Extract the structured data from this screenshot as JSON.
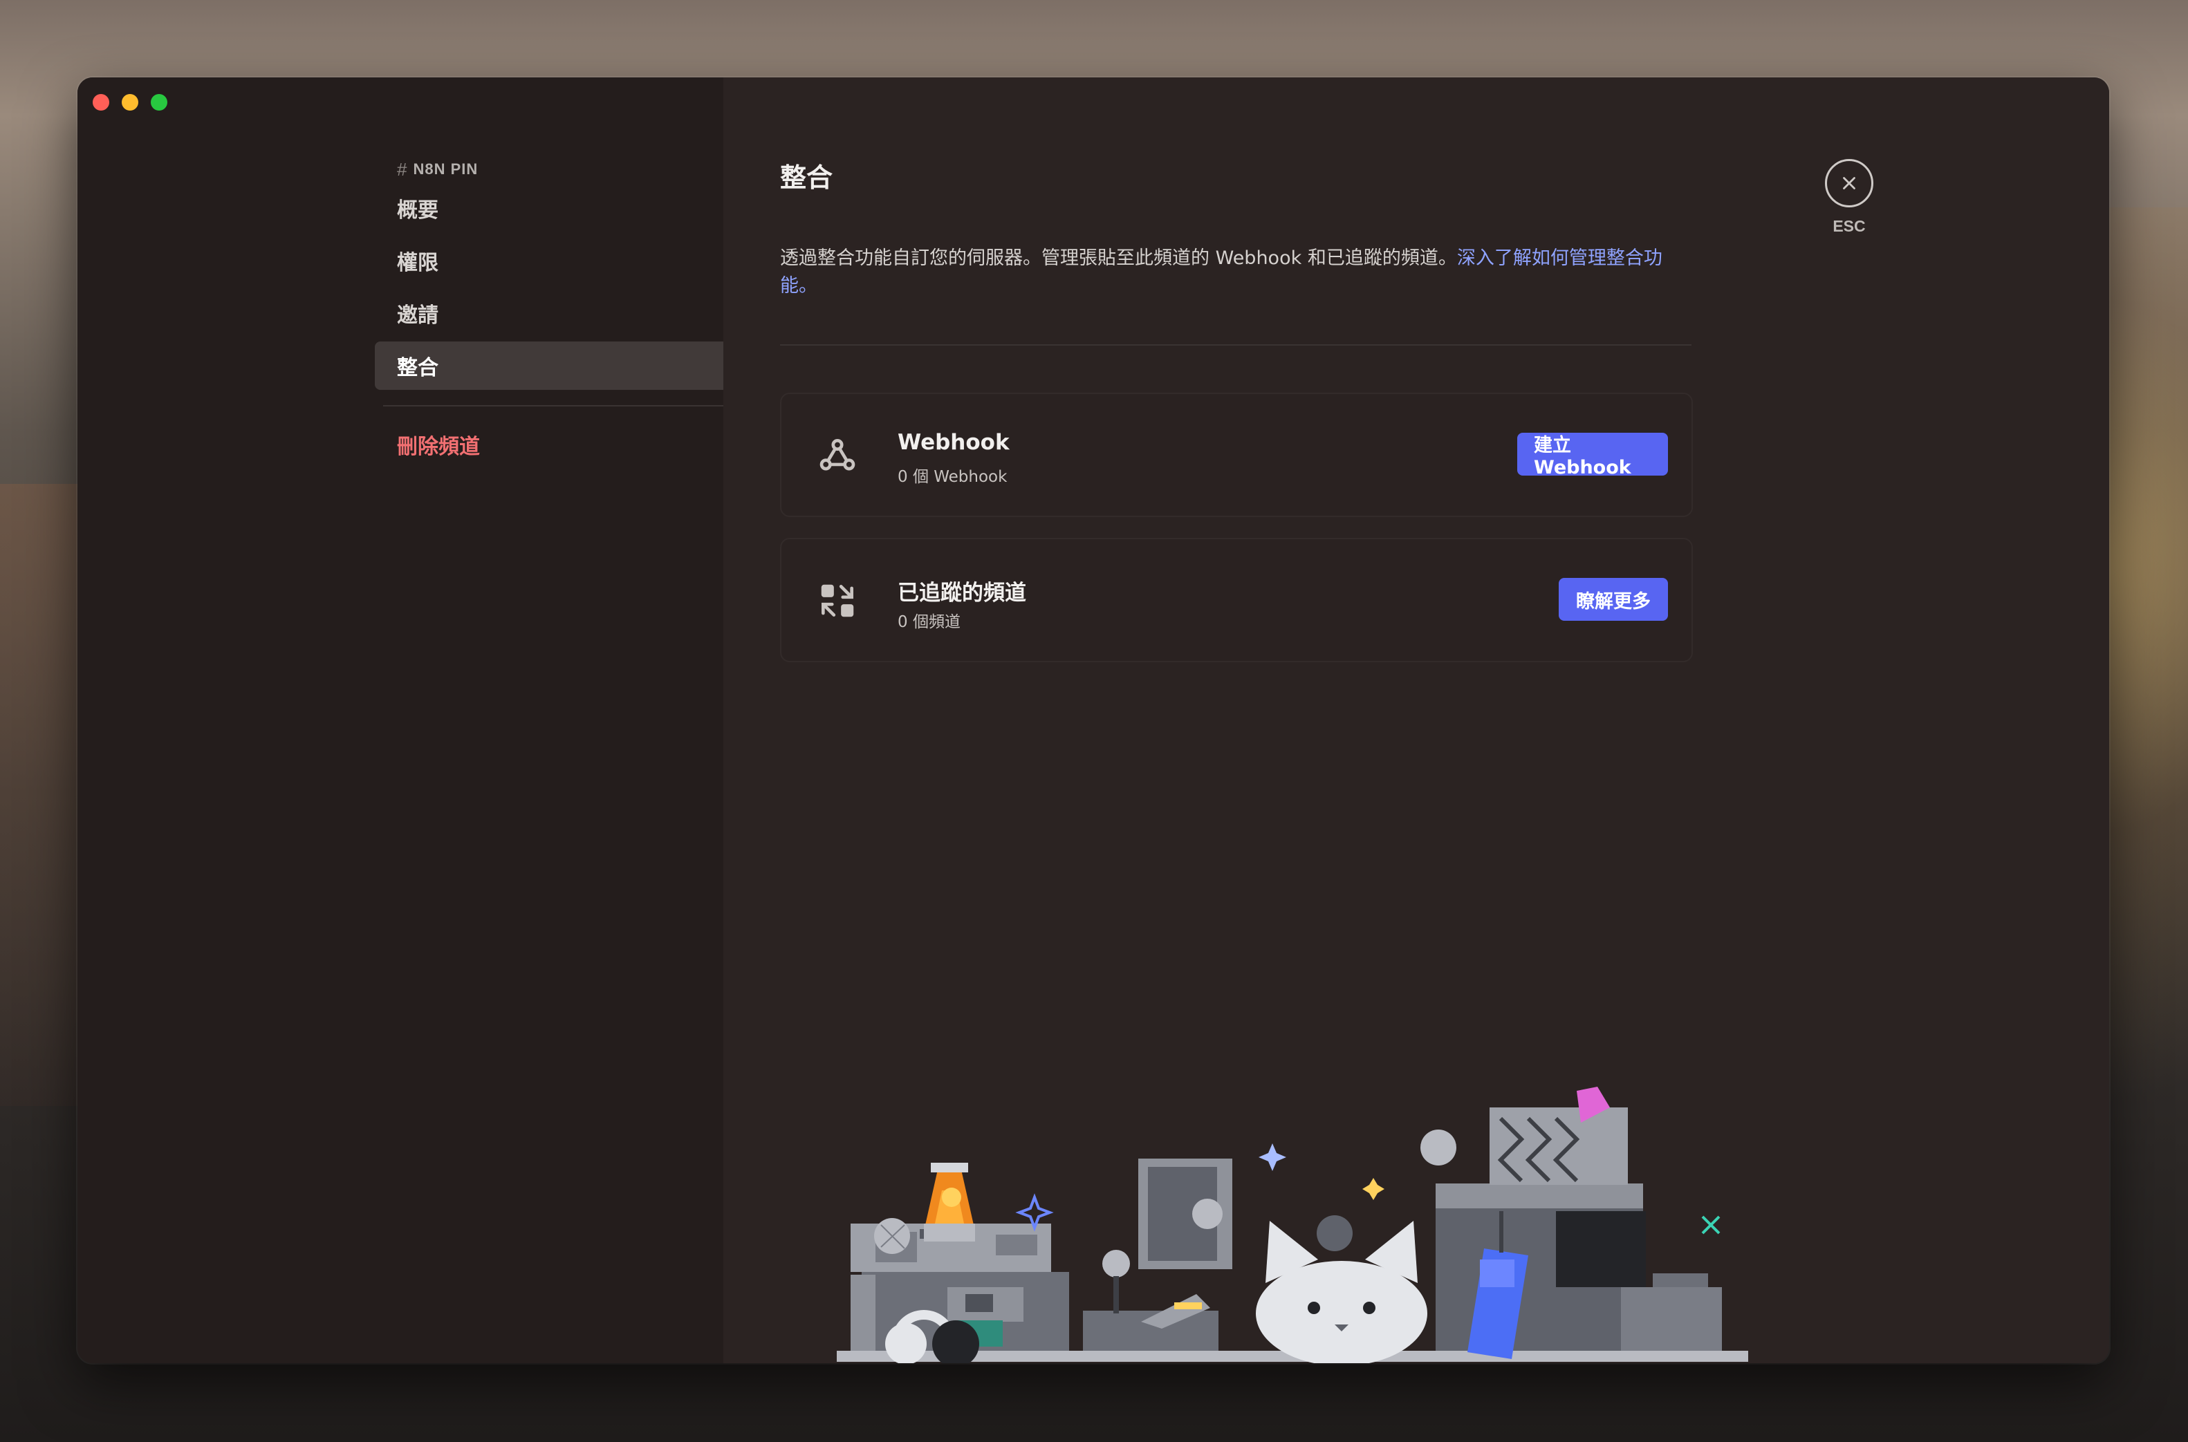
{
  "window": {
    "title": ""
  },
  "sidebar": {
    "header": "N8N PIN",
    "items": [
      {
        "label": "概要",
        "active": false
      },
      {
        "label": "權限",
        "active": false
      },
      {
        "label": "邀請",
        "active": false
      },
      {
        "label": "整合",
        "active": true
      }
    ],
    "danger_label": "刪除頻道"
  },
  "main": {
    "title": "整合",
    "description": "透過整合功能自訂您的伺服器。管理張貼至此頻道的 Webhook 和已追蹤的頻道。",
    "description_link": "深入了解如何管理整合功能。",
    "cards": [
      {
        "title": "Webhook",
        "subtitle": "0 個 Webhook",
        "button": "建立 Webhook",
        "icon": "webhook-icon"
      },
      {
        "title": "已追蹤的頻道",
        "subtitle": "0 個頻道",
        "button": "瞭解更多",
        "icon": "followed-channels-icon"
      }
    ]
  },
  "close": {
    "label": "ESC"
  },
  "colors": {
    "accent": "#5865f2",
    "danger": "#f27072",
    "link": "#8fa3ff"
  }
}
